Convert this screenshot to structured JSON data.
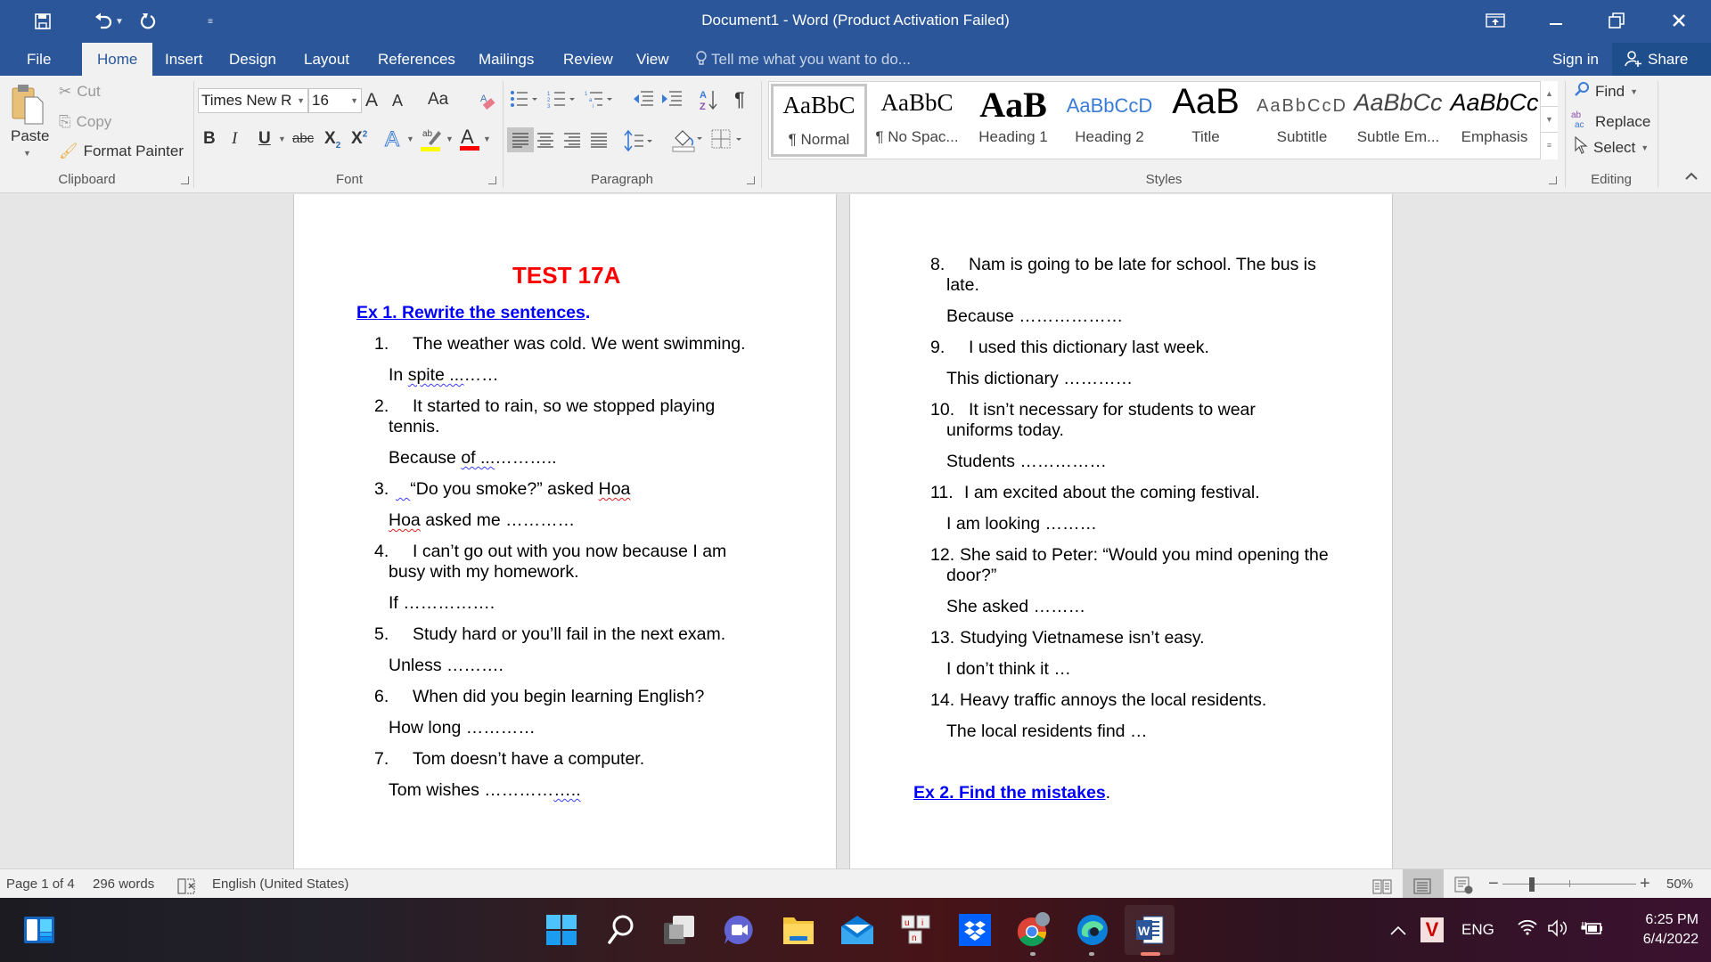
{
  "window": {
    "title": "Document1 - Word (Product Activation Failed)",
    "controls": [
      "ribbon-display-options",
      "minimize",
      "restore",
      "close"
    ]
  },
  "quick_access": {
    "save": "save-icon",
    "undo": "undo-icon",
    "redo": "redo-icon",
    "customize": "customize-qat-icon"
  },
  "tabs": [
    {
      "label": "File",
      "active": false
    },
    {
      "label": "Home",
      "active": true
    },
    {
      "label": "Insert",
      "active": false
    },
    {
      "label": "Design",
      "active": false
    },
    {
      "label": "Layout",
      "active": false
    },
    {
      "label": "References",
      "active": false
    },
    {
      "label": "Mailings",
      "active": false
    },
    {
      "label": "Review",
      "active": false
    },
    {
      "label": "View",
      "active": false
    }
  ],
  "tell_me": {
    "placeholder": "Tell me what you want to do..."
  },
  "account": {
    "sign_in": "Sign in",
    "share": "Share"
  },
  "ribbon": {
    "clipboard": {
      "label": "Clipboard",
      "paste": "Paste",
      "cut": "Cut",
      "copy": "Copy",
      "format_painter": "Format Painter"
    },
    "font": {
      "label": "Font",
      "font_name": "Times New R",
      "font_size": "16",
      "grow": "A",
      "shrink": "A",
      "change_case": "Aa",
      "bold": "B",
      "italic": "I",
      "underline": "U",
      "strikethrough": "abc",
      "subscript": "X",
      "superscript": "X",
      "text_effects": "A",
      "highlight_color": "#ffff00",
      "font_color": "#ff0000"
    },
    "paragraph": {
      "label": "Paragraph",
      "pilcrow": "¶"
    },
    "styles": {
      "label": "Styles",
      "items": [
        {
          "sample": "AaBbC",
          "name": "¶ Normal",
          "selected": true
        },
        {
          "sample": "AaBbC",
          "name": "¶ No Spac...",
          "selected": false
        },
        {
          "sample": "AaB",
          "name": "Heading 1",
          "selected": false
        },
        {
          "sample": "AaBbCcD",
          "name": "Heading 2",
          "selected": false
        },
        {
          "sample": "AaB",
          "name": "Title",
          "selected": false
        },
        {
          "sample": "AaBbCcD",
          "name": "Subtitle",
          "selected": false
        },
        {
          "sample": "AaBbCc",
          "name": "Subtle Em...",
          "selected": false
        },
        {
          "sample": "AaBbCc",
          "name": "Emphasis",
          "selected": false
        }
      ]
    },
    "editing": {
      "label": "Editing",
      "find": "Find",
      "replace": "Replace",
      "select": "Select"
    }
  },
  "document": {
    "title": "TEST 17A",
    "ex1_heading": "Ex 1. Rewrite the sentences",
    "ex1_heading_suffix": ".",
    "ex2_heading": "Ex 2. Find the mistakes",
    "ex2_heading_suffix": ".",
    "items": [
      {
        "num": "1.",
        "text": "The weather was cold. We went swimming.",
        "answer": "In spite ………"
      },
      {
        "num": "2.",
        "text_line1": "It started to rain, so we stopped playing",
        "text_line2": "tennis.",
        "answer": "Because of ………….."
      },
      {
        "num": "3.",
        "text": "“Do you smoke?” asked Hoa",
        "answer": "Hoa asked me …………"
      },
      {
        "num": "4.",
        "text_line1": "I can’t go out with you now because I am",
        "text_line2": "busy with my homework.",
        "answer": "If ……………."
      },
      {
        "num": "5.",
        "text": "Study hard or you’ll fail in the next exam.",
        "answer": "Unless ………."
      },
      {
        "num": "6.",
        "text": "When did you begin learning English?",
        "answer": "How long …………"
      },
      {
        "num": "7.",
        "text": "Tom doesn’t have a computer.",
        "answer": "Tom wishes ……………"
      },
      {
        "num": "8.",
        "text_line1": "Nam is going to be late for school. The bus is",
        "text_line2": "late.",
        "answer": "Because ………………"
      },
      {
        "num": "9.",
        "text": "I used this dictionary last week.",
        "answer": "This dictionary …………"
      },
      {
        "num": "10.",
        "text_line1": "It isn’t necessary for students to wear",
        "text_line2": "uniforms today.",
        "answer": "Students ……………"
      },
      {
        "num": "11.",
        "text": "I am excited about the coming festival.",
        "answer": "I am looking ………"
      },
      {
        "num": "12.",
        "text_line1": "She said to Peter: “Would you mind opening the",
        "text_line2": "door?”",
        "answer": "She asked ………"
      },
      {
        "num": "13.",
        "text": "Studying Vietnamese isn’t easy.",
        "answer": "I don’t think it …"
      },
      {
        "num": "14.",
        "text": "Heavy traffic annoys the local residents.",
        "answer": "The local residents find …"
      }
    ]
  },
  "status": {
    "page": "Page 1 of 4",
    "words": "296 words",
    "language": "English (United States)",
    "zoom": "50%",
    "zoom_percent": 50
  },
  "taskbar": {
    "apps": [
      "start",
      "search",
      "task-view",
      "teams-chat",
      "file-explorer",
      "mail",
      "unikey",
      "dropbox",
      "chrome",
      "edge",
      "word"
    ],
    "tray": {
      "language": "ENG",
      "time": "6:25 PM",
      "date": "6/4/2022"
    }
  }
}
